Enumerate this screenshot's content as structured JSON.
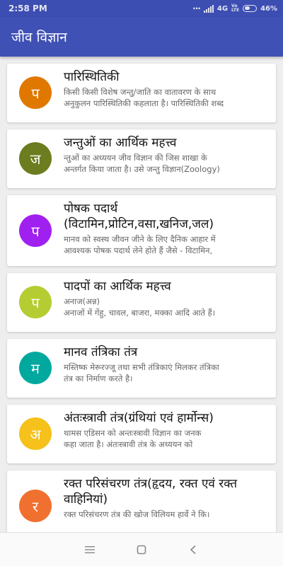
{
  "status_bar": {
    "time": "2:58 PM",
    "network": "4G",
    "volte_top": "Vo",
    "volte_bottom": "LTE",
    "battery": "46%"
  },
  "app_bar": {
    "title": "जीव विज्ञान"
  },
  "topics": [
    {
      "letter": "प",
      "color": "#e07800",
      "title": "पारिस्थितिकी",
      "desc": "किसी किसी विशेष जन्तु/जाति का वातावरण के साथ\nअनुकुलन पारिस्थितिकी कहलाता है। पारिस्थितिकी शब्द"
    },
    {
      "letter": "ज",
      "color": "#6b7d1f",
      "title": "जन्तुओं का आर्थिक महत्त्व",
      "desc": "न्तुओं का अध्ययन जीव विज्ञान की जिस शाखा के\nअन्तर्गत किया जाता है। उसे जन्तु विज्ञान(Zoology)"
    },
    {
      "letter": "प",
      "color": "#a020f0",
      "title": "पोषक पदार्थ\n(विटामिन,प्रोटिन,वसा,खनिज,जल)",
      "desc": "मानव को स्वस्थ जीवन जीने के लिए दैनिक आहार में\nआवश्यक पोषक पदार्थ लेने होते हैं जैसे - विटामिन,"
    },
    {
      "letter": "प",
      "color": "#b5cd32",
      "title": "पादपों का आर्थिक महत्त्व",
      "desc": "अनाज(अन्न)\nअनाजों में गेंहु, चावल, बाजरा, मक्का आदि आते हैं।"
    },
    {
      "letter": "म",
      "color": "#00a89e",
      "title": "मानव तंत्रिका तंत्र",
      "desc": "मस्तिष्क मेरूरज्जू तथा सभी तंत्रिकाएं मिलकर तंत्रिका\nतंत्र का निर्माण करते है।"
    },
    {
      "letter": "अ",
      "color": "#f5c11a",
      "title": "अंतःस्त्रावी तंत्र(ग्रंथियां एवं हार्मोन्स)",
      "desc": "थामस एडिसन को अन्तःस्त्रावी विज्ञान का जनक\nकहा जाता है। अंतःस्त्रावी तंत्र के अध्ययन को"
    },
    {
      "letter": "र",
      "color": "#f07030",
      "title": "रक्त परिसंचरण तंत्र(हृदय, रक्त एवं रक्त\nवाहिनियां)",
      "desc": "रक्त परिसंचरण तंत्र की खोज विलियम हार्वे ने कि।"
    }
  ],
  "nav_bar": {
    "menu_icon": "menu-icon",
    "home_icon": "home-square-icon",
    "back_icon": "back-chevron-icon"
  },
  "colors": {
    "status_bar": "#3d4eb3",
    "app_bar": "#3f51b5",
    "background": "#eeeeee"
  }
}
